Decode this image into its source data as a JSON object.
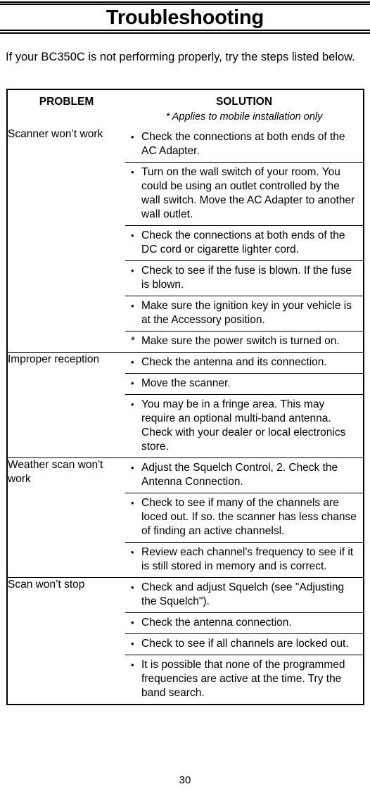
{
  "header": {
    "title": "Troubleshooting"
  },
  "intro": {
    "text": "If your BC350C is not performing properly, try the steps listed below."
  },
  "table": {
    "headers": {
      "problem": "PROBLEM",
      "solution": "SOLUTION",
      "solution_note": "* Applies to mobile installation only"
    },
    "groups": [
      {
        "problem": "Scanner won’t work",
        "solutions": [
          {
            "marker": "•",
            "text": "Check the connections at both ends of the AC Adapter."
          },
          {
            "marker": "•",
            "text": "Turn on the wall switch of your room. You could be using an outlet controlled by the wall switch. Move the AC Adapter to another wall outlet."
          },
          {
            "marker": "•",
            "text": "Check the connections at both ends of the DC cord or cigarette lighter cord."
          },
          {
            "marker": "•",
            "text": "Check to see if the fuse is blown. If the fuse is blown."
          },
          {
            "marker": "•",
            "text": "Make sure the ignition key in your vehicle is at the Accessory position."
          },
          {
            "marker": "*",
            "text": "Make sure the power switch is turned on."
          }
        ]
      },
      {
        "problem": "Improper reception",
        "solutions": [
          {
            "marker": "•",
            "text": "Check the antenna and its connection."
          },
          {
            "marker": "•",
            "text": "Move the scanner."
          },
          {
            "marker": "•",
            "text": "You may be in a fringe area. This may require an optional multi-band antenna. Check with your dealer or local electronics store."
          }
        ]
      },
      {
        "problem": "Weather scan won't work",
        "solutions": [
          {
            "marker": "•",
            "text": "Adjust the Squelch Control, 2. Check the Antenna Connection."
          },
          {
            "marker": "•",
            "text": "Check to see if many of the channels are loced out. If so. the scanner has less chanse of finding an active channelsl."
          },
          {
            "marker": "•",
            "text": "Review each channel's frequency to see if it is still stored in memory and is correct."
          }
        ]
      },
      {
        "problem": "Scan won’t stop",
        "solutions": [
          {
            "marker": "•",
            "text": "Check and adjust Squelch (see \"Adjusting the Squelch\")."
          },
          {
            "marker": "•",
            "text": "Check the antenna connection."
          },
          {
            "marker": "•",
            "text": "Check to see if all channels are locked out."
          },
          {
            "marker": "•",
            "text": "It is possible that none of the programmed frequencies are active at the time. Try the band search."
          }
        ]
      }
    ]
  },
  "footer": {
    "page_number": "30"
  }
}
